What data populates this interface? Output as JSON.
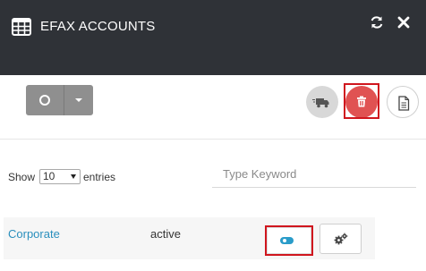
{
  "header": {
    "title": "EFAX ACCOUNTS",
    "icons": [
      "table-icon",
      "refresh-icon",
      "close-icon"
    ]
  },
  "toolbar": {
    "split_button_icon": "circle-icon",
    "dropdown_icon": "caret-down-icon",
    "actions": [
      {
        "name": "truck-icon",
        "color": "#d8d8d8"
      },
      {
        "name": "trash-icon",
        "color": "#e05252",
        "highlighted": true
      },
      {
        "name": "document-icon",
        "color": "#ffffff"
      }
    ]
  },
  "table_controls": {
    "show_label": "Show",
    "entries_value": "10",
    "entries_label": "entries",
    "search_placeholder": "Type Keyword"
  },
  "rows": [
    {
      "name": "Corporate",
      "status": "active",
      "toggle_on": true,
      "toggle_highlighted": true,
      "settings_icon": "gears-icon"
    }
  ],
  "colors": {
    "header_bg": "#2f3237",
    "accent_blue": "#2a8fbd",
    "danger_red": "#e05252",
    "highlight_border": "#d0161e"
  }
}
